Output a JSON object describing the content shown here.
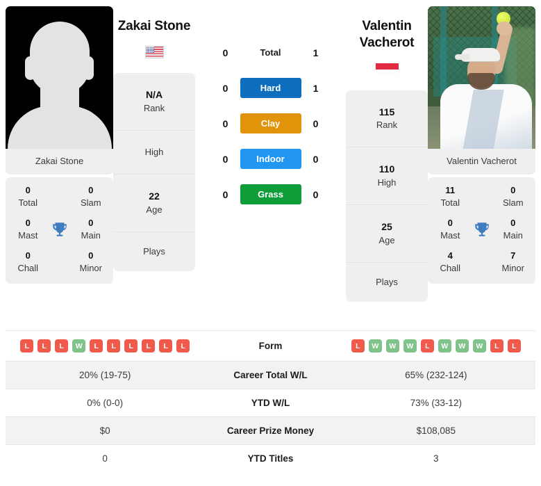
{
  "players": {
    "left": {
      "name": "Zakai Stone",
      "photo_name": "Zakai Stone",
      "flag": "us-flag-icon",
      "avatar": "placeholder-avatar",
      "rank": "N/A",
      "rank_label": "Rank",
      "high": "",
      "high_label": "High",
      "age": "22",
      "age_label": "Age",
      "plays": "",
      "plays_label": "Plays",
      "titles": {
        "card_name": "Zakai Stone",
        "total": "0",
        "total_label": "Total",
        "slam": "0",
        "slam_label": "Slam",
        "mast": "0",
        "mast_label": "Mast",
        "main": "0",
        "main_label": "Main",
        "chall": "0",
        "chall_label": "Chall",
        "minor": "0",
        "minor_label": "Minor"
      }
    },
    "right": {
      "name_line1": "Valentin",
      "name_line2": "Vacherot",
      "photo_name": "Valentin Vacherot",
      "flag": "monaco-flag-icon",
      "avatar": "tennis-serve-photo",
      "rank": "115",
      "rank_label": "Rank",
      "high": "110",
      "high_label": "High",
      "age": "25",
      "age_label": "Age",
      "plays": "",
      "plays_label": "Plays",
      "titles": {
        "card_name": "Valentin Vacherot",
        "total": "11",
        "total_label": "Total",
        "slam": "0",
        "slam_label": "Slam",
        "mast": "0",
        "mast_label": "Mast",
        "main": "0",
        "main_label": "Main",
        "chall": "4",
        "chall_label": "Chall",
        "minor": "7",
        "minor_label": "Minor"
      }
    }
  },
  "head_to_head": {
    "rows": [
      {
        "left": "0",
        "label": "Total",
        "right": "1",
        "color": ""
      },
      {
        "left": "0",
        "label": "Hard",
        "right": "1",
        "color": "#0d6ebd"
      },
      {
        "left": "0",
        "label": "Clay",
        "right": "0",
        "color": "#e1930a"
      },
      {
        "left": "0",
        "label": "Indoor",
        "right": "0",
        "color": "#2196f3"
      },
      {
        "left": "0",
        "label": "Grass",
        "right": "0",
        "color": "#0f9d3a"
      }
    ]
  },
  "stats_table": {
    "form_label": "Form",
    "form_left": [
      "L",
      "L",
      "L",
      "W",
      "L",
      "L",
      "L",
      "L",
      "L",
      "L"
    ],
    "form_right": [
      "L",
      "W",
      "W",
      "W",
      "L",
      "W",
      "W",
      "W",
      "L",
      "L"
    ],
    "rows": [
      {
        "left": "20% (19-75)",
        "label": "Career Total W/L",
        "right": "65% (232-124)"
      },
      {
        "left": "0% (0-0)",
        "label": "YTD W/L",
        "right": "73% (33-12)"
      },
      {
        "left": "$0",
        "label": "Career Prize Money",
        "right": "$108,085"
      },
      {
        "left": "0",
        "label": "YTD Titles",
        "right": "3"
      }
    ]
  },
  "colors": {
    "win": "#7fc28a",
    "loss": "#f05a4b",
    "trophy": "#3f7cc0",
    "card_bg": "#efefef",
    "row_alt": "#f2f2f2"
  }
}
